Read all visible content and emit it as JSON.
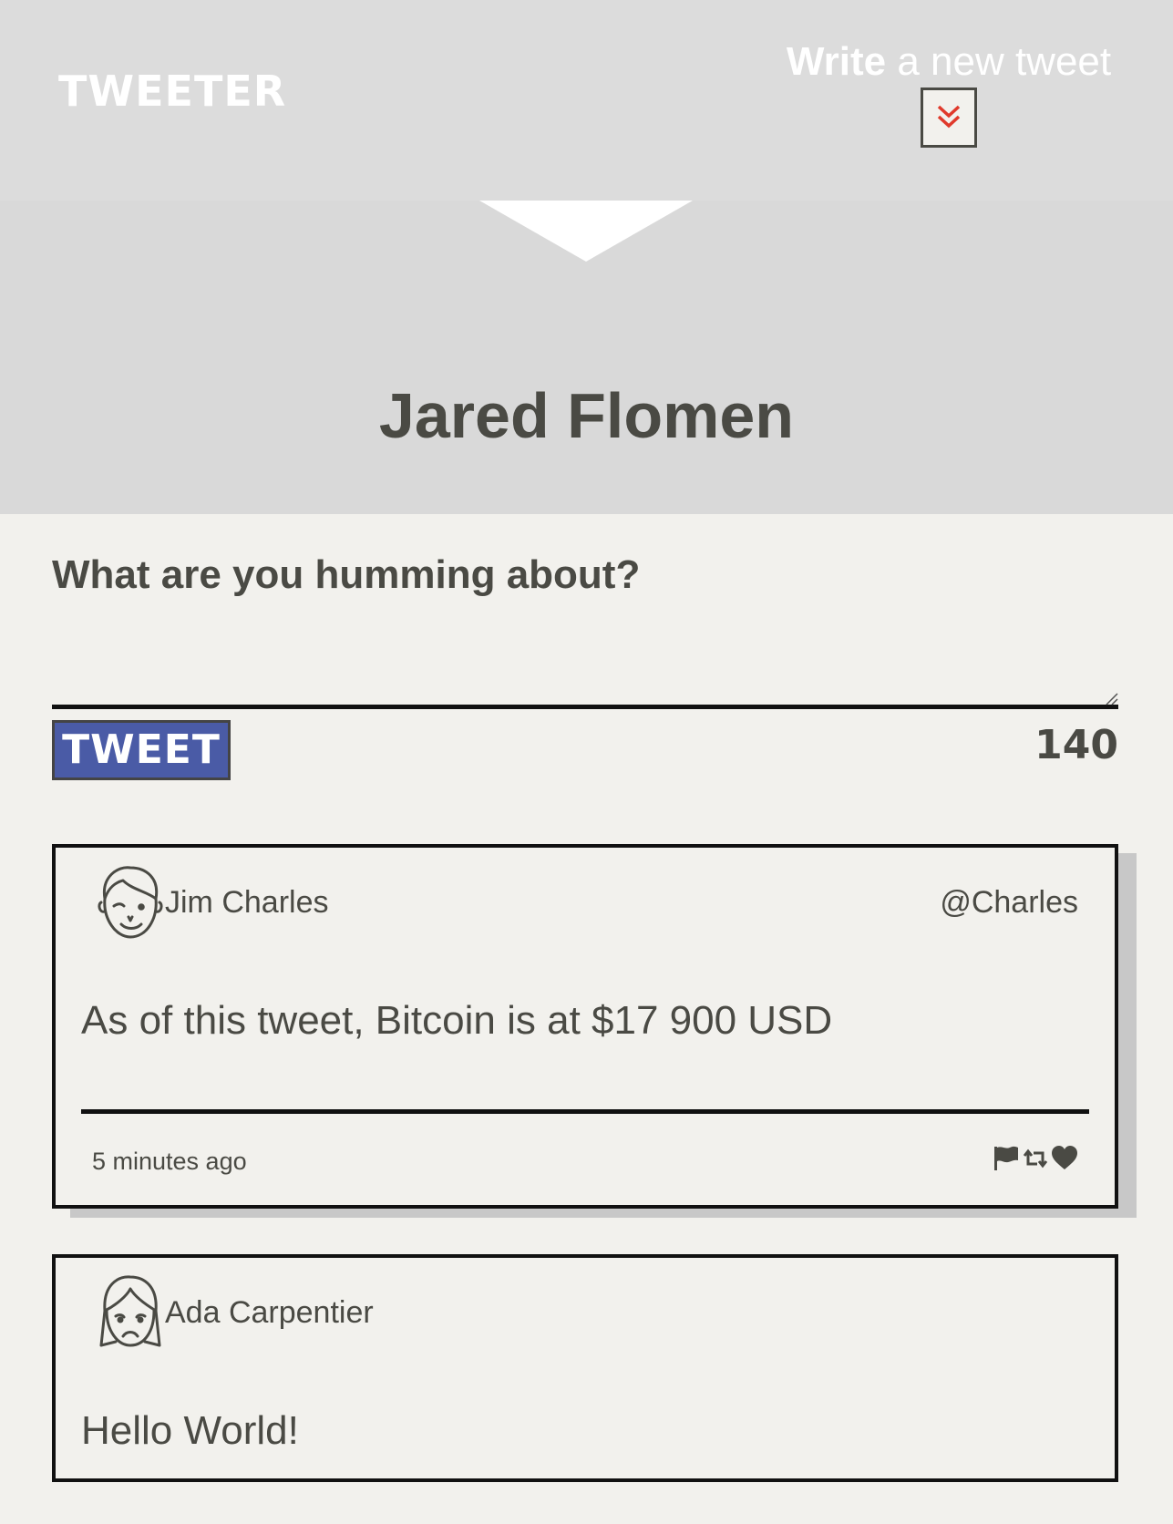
{
  "nav": {
    "logo": "TWEETER",
    "compose_strong": "Write",
    "compose_rest": " a new tweet",
    "compose_icon": "double-chevron-down-icon",
    "compose_icon_color": "#e03a2c"
  },
  "profile": {
    "name": "Jared Flomen"
  },
  "composer": {
    "title": "What are you humming about?",
    "placeholder": "",
    "submit_label": "TWEET",
    "counter": "140",
    "button_color": "#4a5ba6"
  },
  "tweets": [
    {
      "user": "Jim Charles",
      "handle": "@Charles",
      "text": "As of this tweet, Bitcoin is at $17 900 USD",
      "time": "5 minutes ago",
      "avatar": "man-face-icon",
      "actions": [
        "flag-icon",
        "retweet-icon",
        "heart-icon"
      ]
    },
    {
      "user": "Ada Carpentier",
      "handle": "",
      "text": "Hello World!",
      "avatar": "woman-face-icon"
    }
  ]
}
